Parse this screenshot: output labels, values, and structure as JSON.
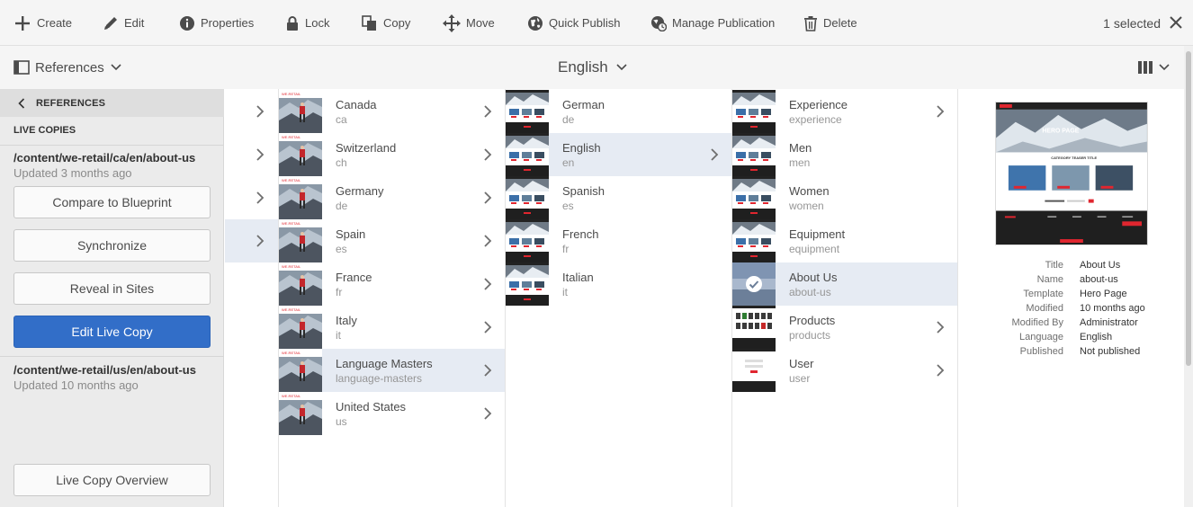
{
  "actionbar": {
    "create": "Create",
    "edit": "Edit",
    "properties": "Properties",
    "lock": "Lock",
    "copy": "Copy",
    "move": "Move",
    "quick_publish": "Quick Publish",
    "manage_publication": "Manage Publication",
    "delete": "Delete",
    "selected": "1 selected"
  },
  "titlebar": {
    "rail_toggle": "References",
    "title": "English"
  },
  "rail": {
    "header": "REFERENCES",
    "section": "LIVE COPIES",
    "copies": [
      {
        "path": "/content/we-retail/ca/en/about-us",
        "updated": "Updated 3 months ago"
      },
      {
        "path": "/content/we-retail/us/en/about-us",
        "updated": "Updated 10 months ago"
      }
    ],
    "buttons": {
      "compare": "Compare to Blueprint",
      "synchronize": "Synchronize",
      "reveal": "Reveal in Sites",
      "edit_live_copy": "Edit Live Copy",
      "overview": "Live Copy Overview"
    }
  },
  "columns": {
    "countries": [
      {
        "title": "Canada",
        "name": "ca"
      },
      {
        "title": "Switzerland",
        "name": "ch"
      },
      {
        "title": "Germany",
        "name": "de"
      },
      {
        "title": "Spain",
        "name": "es"
      },
      {
        "title": "France",
        "name": "fr"
      },
      {
        "title": "Italy",
        "name": "it"
      },
      {
        "title": "Language Masters",
        "name": "language-masters"
      },
      {
        "title": "United States",
        "name": "us"
      }
    ],
    "languages": [
      {
        "title": "German",
        "name": "de"
      },
      {
        "title": "English",
        "name": "en"
      },
      {
        "title": "Spanish",
        "name": "es"
      },
      {
        "title": "French",
        "name": "fr"
      },
      {
        "title": "Italian",
        "name": "it"
      }
    ],
    "pages": [
      {
        "title": "Experience",
        "name": "experience"
      },
      {
        "title": "Men",
        "name": "men"
      },
      {
        "title": "Women",
        "name": "women"
      },
      {
        "title": "Equipment",
        "name": "equipment"
      },
      {
        "title": "About Us",
        "name": "about-us"
      },
      {
        "title": "Products",
        "name": "products"
      },
      {
        "title": "User",
        "name": "user"
      }
    ]
  },
  "preview": {
    "image_text": {
      "hero": "HERO PAGE",
      "category": "CATEGORY TEASER TITLE"
    },
    "meta": [
      {
        "key": "Title",
        "value": "About Us"
      },
      {
        "key": "Name",
        "value": "about-us"
      },
      {
        "key": "Template",
        "value": "Hero Page"
      },
      {
        "key": "Modified",
        "value": "10 months ago"
      },
      {
        "key": "Modified By",
        "value": "Administrator"
      },
      {
        "key": "Language",
        "value": "English"
      },
      {
        "key": "Published",
        "value": "Not published"
      }
    ]
  },
  "colors": {
    "accent": "#326ec8",
    "selected_row": "#e6ebf3",
    "brand_red": "#e0262f"
  }
}
